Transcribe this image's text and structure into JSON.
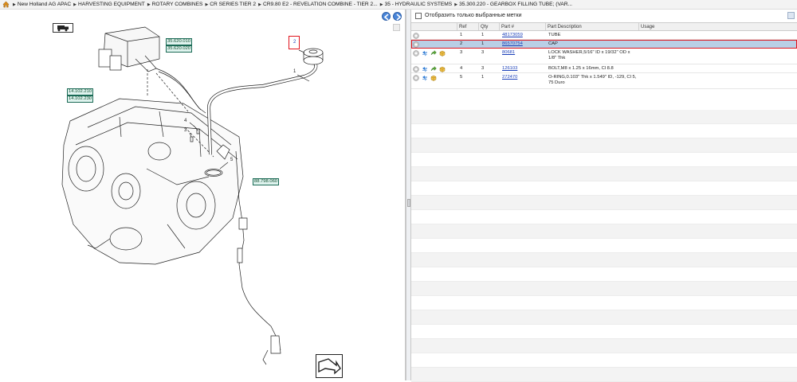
{
  "breadcrumb": [
    "New Holland AG APAC",
    "HARVESTING EQUIPMENT",
    "ROTARY COMBINES",
    "CR SERIES TIER 2",
    "CR9.80 E2 - REVELATION COMBINE - TIER 2...",
    "35 - HYDRAULIC SYSTEMS",
    "35.300.220 - GEARBOX FILLING TUBE; (VAR..."
  ],
  "diagram": {
    "callouts": [
      "35.620.010",
      "35.620.020",
      "14.102.210",
      "14.102.230",
      "88.798.060"
    ],
    "item_numbers": [
      "1",
      "2",
      "3",
      "4",
      "5"
    ]
  },
  "filter": {
    "label": "Отобразить только выбранные метки"
  },
  "grid": {
    "headers": {
      "ref": "Ref",
      "qty": "Qty",
      "part": "Part #",
      "desc": "Part Description",
      "usage": "Usage"
    },
    "rows": [
      {
        "ref": "1",
        "qty": "1",
        "part": "48173059",
        "desc": "TUBE",
        "usage": "",
        "icons": [
          "info"
        ]
      },
      {
        "ref": "2",
        "qty": "1",
        "part": "86570754",
        "desc": "CAP",
        "usage": "",
        "icons": [
          "info"
        ],
        "selected": true
      },
      {
        "ref": "3",
        "qty": "3",
        "part": "80681",
        "desc": "LOCK WASHER,5/16\" ID x 19/32\" OD x 1/8\" Thk",
        "usage": "",
        "icons": [
          "info",
          "swap",
          "arrow",
          "box"
        ]
      },
      {
        "ref": "4",
        "qty": "3",
        "part": "126103",
        "desc": "BOLT,M8 x 1.25 x 16mm, Cl 8.8",
        "usage": "",
        "icons": [
          "info",
          "swap",
          "arrow",
          "box"
        ]
      },
      {
        "ref": "5",
        "qty": "1",
        "part": "272470",
        "desc": "O-RING,0.103\" Thk x 1.549\" ID, -129, Cl 5, 75 Duro",
        "usage": "",
        "icons": [
          "info",
          "swap",
          "box"
        ]
      }
    ]
  },
  "colors": {
    "selected_row": "#b9cfe6",
    "highlight": "#e0141e",
    "link": "#1a3fb8",
    "callout_bg": "#dff3ee"
  }
}
